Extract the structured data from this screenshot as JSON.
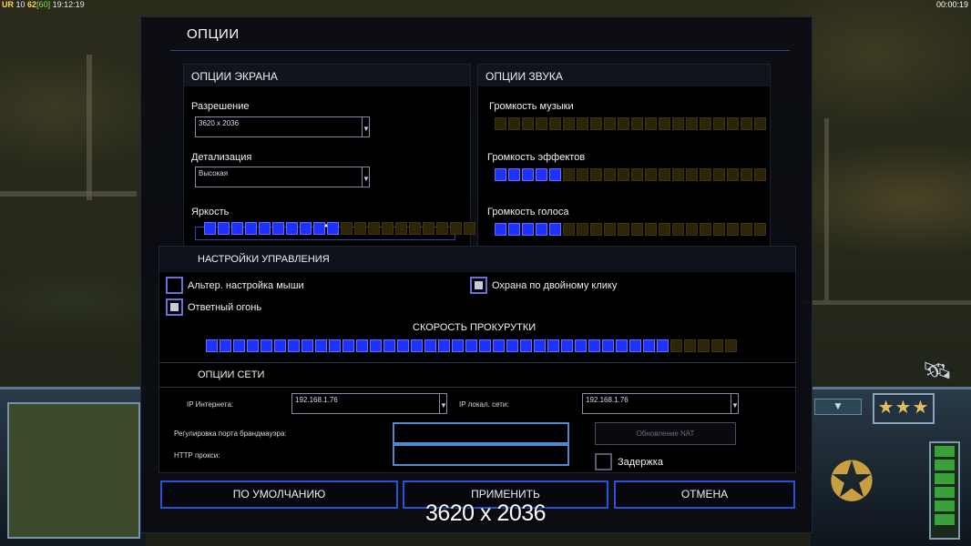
{
  "top_bar": {
    "label": "UR",
    "stat1": "10",
    "stat2": "62",
    "fps": "[60]",
    "clock": "19:12:19",
    "game_time": "00:00:19"
  },
  "dialog": {
    "title": "ОПЦИИ"
  },
  "screen": {
    "header": "ОПЦИИ ЭКРАНА",
    "resolution_label": "Разрешение",
    "resolution_value": "3620 x 2036",
    "detail_label": "Детализация",
    "detail_value": "Высокая",
    "brightness_label": "Яркость",
    "brightness_level": 0.5,
    "brightness_cells": 20,
    "brightness_on": 10,
    "brightness_marker": "▲"
  },
  "sound": {
    "header": "ОПЦИИ ЗВУКА",
    "music_label": "Громкость музыки",
    "music_cells": 20,
    "music_on": 0,
    "effects_label": "Громкость эффектов",
    "effects_cells": 20,
    "effects_on": 5,
    "voice_label": "Громкость голоса",
    "voice_cells": 20,
    "voice_on": 5
  },
  "control": {
    "header": "НАСТРОЙКИ УПРАВЛЕНИЯ",
    "alt_mouse_label": "Альтер. настройка мыши",
    "alt_mouse_checked": false,
    "double_click_guard_label": "Охрана по двойному клику",
    "double_click_guard_checked": true,
    "return_fire_label": "Ответный огонь",
    "return_fire_checked": true,
    "scroll_speed_label": "СКОРОСТЬ ПРОКУРУТКИ",
    "scroll_cells": 39,
    "scroll_on": 34
  },
  "network": {
    "header": "ОПЦИИ СЕТИ",
    "internet_ip_label": "IP Интернета:",
    "internet_ip_value": "192.168.1.76",
    "lan_ip_label": "IP локал. сети:",
    "lan_ip_value": "192.168.1.76",
    "firewall_label": "Регулировка порта брандмауэра:",
    "http_proxy_label": "HTTP прокси:",
    "nat_button": "Обновление NAT",
    "delay_label": "Задержка",
    "delay_checked": false
  },
  "buttons": {
    "defaults": "ПО УМОЛЧАНИЮ",
    "apply": "ПРИМЕНИТЬ",
    "cancel": "ОТМЕНА"
  },
  "overlay": {
    "resolution_caption": "3620 x 2036"
  },
  "hud": {
    "stars": "★★★"
  },
  "colors": {
    "slider_on": "#1e32ff",
    "slider_off": "#2c2508",
    "button_border": "#2a52d4",
    "input_border": "#4d8ad0"
  }
}
